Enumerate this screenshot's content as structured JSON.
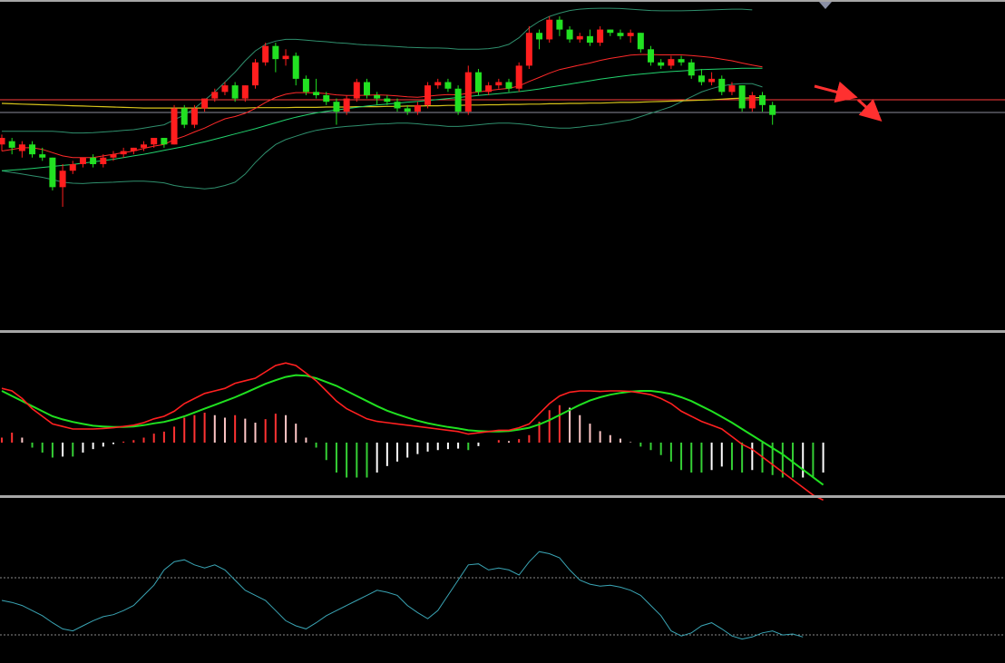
{
  "chart_data": {
    "type": "candlestick",
    "xlabel": "",
    "ylabel": "",
    "price": {
      "ylim": [
        0,
        100
      ],
      "support_level": 69.6,
      "candles": [
        {
          "o": 56,
          "c": 58,
          "h": 59,
          "l": 54
        },
        {
          "o": 57,
          "c": 55,
          "h": 58,
          "l": 53
        },
        {
          "o": 54,
          "c": 56,
          "h": 57,
          "l": 52
        },
        {
          "o": 56,
          "c": 53,
          "h": 57,
          "l": 52
        },
        {
          "o": 53,
          "c": 52,
          "h": 55,
          "l": 51
        },
        {
          "o": 52,
          "c": 43,
          "h": 52,
          "l": 42
        },
        {
          "o": 43,
          "c": 48,
          "h": 50,
          "l": 37
        },
        {
          "o": 48,
          "c": 50,
          "h": 51,
          "l": 47
        },
        {
          "o": 50,
          "c": 52,
          "h": 52,
          "l": 49
        },
        {
          "o": 52,
          "c": 50,
          "h": 53,
          "l": 49
        },
        {
          "o": 50,
          "c": 52,
          "h": 53,
          "l": 49
        },
        {
          "o": 52,
          "c": 53,
          "h": 54,
          "l": 51
        },
        {
          "o": 53,
          "c": 54,
          "h": 55,
          "l": 52
        },
        {
          "o": 54,
          "c": 55,
          "h": 55,
          "l": 53
        },
        {
          "o": 55,
          "c": 56,
          "h": 57,
          "l": 54
        },
        {
          "o": 56,
          "c": 58,
          "h": 58,
          "l": 55
        },
        {
          "o": 58,
          "c": 56,
          "h": 58,
          "l": 55
        },
        {
          "o": 56,
          "c": 67,
          "h": 68,
          "l": 56
        },
        {
          "o": 67,
          "c": 62,
          "h": 68,
          "l": 61
        },
        {
          "o": 62,
          "c": 67,
          "h": 68,
          "l": 61
        },
        {
          "o": 67,
          "c": 70,
          "h": 70,
          "l": 66
        },
        {
          "o": 70,
          "c": 72,
          "h": 73,
          "l": 69
        },
        {
          "o": 72,
          "c": 74,
          "h": 75,
          "l": 71
        },
        {
          "o": 74,
          "c": 70,
          "h": 75,
          "l": 69
        },
        {
          "o": 70,
          "c": 74,
          "h": 74,
          "l": 69
        },
        {
          "o": 74,
          "c": 81,
          "h": 82,
          "l": 73
        },
        {
          "o": 81,
          "c": 86,
          "h": 87,
          "l": 80
        },
        {
          "o": 86,
          "c": 82,
          "h": 87,
          "l": 78
        },
        {
          "o": 82,
          "c": 83,
          "h": 85,
          "l": 80
        },
        {
          "o": 83,
          "c": 76,
          "h": 84,
          "l": 74
        },
        {
          "o": 76,
          "c": 72,
          "h": 77,
          "l": 71
        },
        {
          "o": 72,
          "c": 71,
          "h": 76,
          "l": 70
        },
        {
          "o": 71,
          "c": 69,
          "h": 72,
          "l": 68
        },
        {
          "o": 69,
          "c": 66,
          "h": 70,
          "l": 62
        },
        {
          "o": 66,
          "c": 70,
          "h": 71,
          "l": 65
        },
        {
          "o": 70,
          "c": 75,
          "h": 76,
          "l": 69
        },
        {
          "o": 75,
          "c": 71,
          "h": 76,
          "l": 70
        },
        {
          "o": 71,
          "c": 70,
          "h": 72,
          "l": 68
        },
        {
          "o": 70,
          "c": 69,
          "h": 71,
          "l": 68
        },
        {
          "o": 69,
          "c": 67,
          "h": 70,
          "l": 66
        },
        {
          "o": 67,
          "c": 66,
          "h": 68,
          "l": 65
        },
        {
          "o": 66,
          "c": 68,
          "h": 69,
          "l": 65
        },
        {
          "o": 68,
          "c": 74,
          "h": 75,
          "l": 67
        },
        {
          "o": 74,
          "c": 75,
          "h": 76,
          "l": 73
        },
        {
          "o": 75,
          "c": 73,
          "h": 76,
          "l": 72
        },
        {
          "o": 73,
          "c": 66,
          "h": 74,
          "l": 65
        },
        {
          "o": 66,
          "c": 78,
          "h": 80,
          "l": 65
        },
        {
          "o": 78,
          "c": 72,
          "h": 79,
          "l": 71
        },
        {
          "o": 72,
          "c": 74,
          "h": 75,
          "l": 71
        },
        {
          "o": 74,
          "c": 75,
          "h": 76,
          "l": 73
        },
        {
          "o": 75,
          "c": 73,
          "h": 76,
          "l": 72
        },
        {
          "o": 73,
          "c": 80,
          "h": 81,
          "l": 72
        },
        {
          "o": 80,
          "c": 90,
          "h": 92,
          "l": 79
        },
        {
          "o": 90,
          "c": 88,
          "h": 91,
          "l": 85
        },
        {
          "o": 88,
          "c": 94,
          "h": 95,
          "l": 87
        },
        {
          "o": 94,
          "c": 91,
          "h": 95,
          "l": 89
        },
        {
          "o": 91,
          "c": 88,
          "h": 92,
          "l": 87
        },
        {
          "o": 88,
          "c": 89,
          "h": 90,
          "l": 87
        },
        {
          "o": 89,
          "c": 87,
          "h": 91,
          "l": 86
        },
        {
          "o": 87,
          "c": 91,
          "h": 92,
          "l": 86
        },
        {
          "o": 91,
          "c": 90,
          "h": 91,
          "l": 89
        },
        {
          "o": 90,
          "c": 89,
          "h": 91,
          "l": 88
        },
        {
          "o": 89,
          "c": 90,
          "h": 91,
          "l": 87
        },
        {
          "o": 90,
          "c": 85,
          "h": 90,
          "l": 84
        },
        {
          "o": 85,
          "c": 81,
          "h": 86,
          "l": 80
        },
        {
          "o": 81,
          "c": 80,
          "h": 82,
          "l": 79
        },
        {
          "o": 80,
          "c": 82,
          "h": 83,
          "l": 79
        },
        {
          "o": 82,
          "c": 81,
          "h": 83,
          "l": 80
        },
        {
          "o": 81,
          "c": 77,
          "h": 82,
          "l": 76
        },
        {
          "o": 77,
          "c": 75,
          "h": 79,
          "l": 74
        },
        {
          "o": 75,
          "c": 76,
          "h": 78,
          "l": 74
        },
        {
          "o": 76,
          "c": 72,
          "h": 77,
          "l": 71
        },
        {
          "o": 72,
          "c": 74,
          "h": 75,
          "l": 71
        },
        {
          "o": 74,
          "c": 67,
          "h": 74,
          "l": 66
        },
        {
          "o": 67,
          "c": 71,
          "h": 72,
          "l": 66
        },
        {
          "o": 71,
          "c": 68,
          "h": 72,
          "l": 66
        },
        {
          "o": 68,
          "c": 65,
          "h": 69,
          "l": 62
        }
      ],
      "ma_short": [
        54,
        54.5,
        55,
        55,
        54.5,
        53.5,
        52.5,
        52,
        52,
        52,
        52.5,
        53,
        53.5,
        54,
        54.8,
        55.5,
        56,
        57.5,
        58.5,
        59.8,
        61,
        62.5,
        63.8,
        64.5,
        65.5,
        67,
        68.8,
        70.3,
        71.3,
        71.8,
        71.8,
        71.7,
        71.5,
        71.1,
        70.9,
        70.9,
        71,
        71.1,
        71,
        70.8,
        70.5,
        70.4,
        70.7,
        71,
        71.2,
        71.1,
        71.6,
        72,
        72.4,
        72.8,
        73.1,
        73.8,
        75.2,
        76.4,
        77.7,
        78.8,
        79.5,
        80.2,
        80.8,
        81.6,
        82.2,
        82.7,
        83.2,
        83.4,
        83.4,
        83.3,
        83.3,
        83.3,
        83.1,
        82.8,
        82.5,
        82,
        81.5,
        80.8,
        80.2,
        79.6
      ],
      "ma_long": [
        48,
        48.2,
        48.4,
        48.7,
        49,
        49.3,
        49.6,
        49.9,
        50.3,
        50.7,
        51.1,
        51.5,
        52,
        52.5,
        53,
        53.6,
        54.2,
        54.8,
        55.4,
        56.1,
        56.8,
        57.6,
        58.4,
        59.2,
        60,
        60.8,
        61.7,
        62.6,
        63.5,
        64.3,
        65,
        65.6,
        66.1,
        66.5,
        66.9,
        67.3,
        67.7,
        68,
        68.3,
        68.6,
        68.9,
        69.1,
        69.4,
        69.7,
        70,
        70.3,
        70.6,
        70.9,
        71.2,
        71.5,
        71.8,
        72.1,
        72.5,
        72.9,
        73.4,
        73.9,
        74.4,
        74.9,
        75.4,
        75.9,
        76.3,
        76.7,
        77.1,
        77.4,
        77.7,
        78,
        78.2,
        78.4,
        78.6,
        78.8,
        78.9,
        79,
        79.1,
        79.2,
        79.2,
        79.2
      ],
      "ma_yearly": [
        68.5,
        68.4,
        68.3,
        68.2,
        68.1,
        68,
        67.9,
        67.8,
        67.7,
        67.6,
        67.5,
        67.4,
        67.3,
        67.2,
        67.1,
        67.1,
        67.1,
        67.1,
        67.1,
        67.1,
        67.1,
        67.1,
        67.1,
        67.1,
        67.1,
        67.2,
        67.2,
        67.2,
        67.2,
        67.3,
        67.3,
        67.3,
        67.4,
        67.4,
        67.4,
        67.5,
        67.5,
        67.5,
        67.6,
        67.6,
        67.7,
        67.7,
        67.8,
        67.8,
        67.9,
        67.9,
        68,
        68,
        68.1,
        68.1,
        68.2,
        68.2,
        68.3,
        68.3,
        68.4,
        68.4,
        68.5,
        68.5,
        68.6,
        68.6,
        68.7,
        68.8,
        68.8,
        68.9,
        69,
        69.1,
        69.2,
        69.3,
        69.4,
        69.5,
        69.6,
        69.8,
        70,
        70.1,
        70.2,
        70.3
      ],
      "boll_upper": [
        60,
        60,
        60,
        60,
        60,
        60,
        59.8,
        59.5,
        59.5,
        59.6,
        59.8,
        60,
        60.3,
        60.5,
        61,
        61.5,
        62,
        63.5,
        65,
        67,
        69.5,
        72,
        75,
        78,
        81.5,
        84.5,
        86.5,
        87.5,
        88,
        88,
        87.8,
        87.5,
        87.3,
        87,
        86.8,
        86.5,
        86.3,
        86.2,
        86,
        85.8,
        85.6,
        85.5,
        85.4,
        85.4,
        85.3,
        85,
        85,
        85,
        85.2,
        85.6,
        86.5,
        88.5,
        91.5,
        93.5,
        95,
        96,
        96.8,
        97.2,
        97.4,
        97.5,
        97.5,
        97.4,
        97.2,
        97,
        96.8,
        96.7,
        96.7,
        96.7,
        96.8,
        96.9,
        97,
        97.1,
        97.2,
        97.2,
        97
      ],
      "boll_lower": [
        48,
        47.5,
        47,
        46.5,
        46,
        45.3,
        44.5,
        44.2,
        44.1,
        44.3,
        44.4,
        44.5,
        44.7,
        44.8,
        44.8,
        44.6,
        44.3,
        43.5,
        43,
        42.8,
        42.5,
        42.8,
        43.5,
        44.5,
        47,
        50.5,
        53.5,
        56,
        57.5,
        58.5,
        59.5,
        60.3,
        60.8,
        61.2,
        61.5,
        61.7,
        62,
        62.2,
        62.3,
        62.5,
        62.5,
        62.3,
        62,
        61.8,
        61.5,
        61.5,
        61.7,
        62,
        62.3,
        62.5,
        62.5,
        62.3,
        62,
        61.5,
        61.2,
        61,
        61,
        61.3,
        61.7,
        62,
        62.5,
        63,
        63.5,
        64.5,
        65.5,
        66.5,
        67.5,
        69,
        70.5,
        72,
        73,
        73.8,
        74.3,
        74.5,
        74.5,
        73.5
      ],
      "projection": {
        "start": 73,
        "low": 69.6,
        "end": 75
      }
    },
    "macd": {
      "dif": [
        0.6,
        0.5,
        0.2,
        -0.2,
        -0.5,
        -0.8,
        -0.9,
        -1,
        -1,
        -1,
        -0.98,
        -0.95,
        -0.9,
        -0.85,
        -0.75,
        -0.6,
        -0.5,
        -0.3,
        0,
        0.2,
        0.4,
        0.5,
        0.6,
        0.8,
        0.9,
        1,
        1.25,
        1.5,
        1.6,
        1.5,
        1.2,
        0.9,
        0.5,
        0.1,
        -0.2,
        -0.4,
        -0.6,
        -0.7,
        -0.75,
        -0.8,
        -0.85,
        -0.9,
        -0.95,
        -1,
        -1.05,
        -1.1,
        -1.2,
        -1.15,
        -1.1,
        -1.05,
        -1.05,
        -0.95,
        -0.8,
        -0.4,
        0,
        0.3,
        0.45,
        0.5,
        0.5,
        0.48,
        0.5,
        0.5,
        0.48,
        0.42,
        0.35,
        0.2,
        0,
        -0.3,
        -0.5,
        -0.7,
        -0.85,
        -1,
        -1.3,
        -1.6,
        -1.8,
        -2.1,
        -2.4,
        -2.7,
        -3,
        -3.3,
        -3.6,
        -3.8
      ],
      "dea": [
        0.5,
        0.3,
        0.1,
        -0.1,
        -0.3,
        -0.5,
        -0.62,
        -0.72,
        -0.8,
        -0.87,
        -0.9,
        -0.92,
        -0.92,
        -0.9,
        -0.85,
        -0.78,
        -0.72,
        -0.62,
        -0.5,
        -0.35,
        -0.2,
        -0.05,
        0.1,
        0.25,
        0.42,
        0.6,
        0.78,
        0.92,
        1.05,
        1.12,
        1.1,
        1.0,
        0.85,
        0.7,
        0.5,
        0.3,
        0.1,
        -0.1,
        -0.28,
        -0.42,
        -0.55,
        -0.67,
        -0.77,
        -0.85,
        -0.92,
        -0.98,
        -1.05,
        -1.08,
        -1.1,
        -1.1,
        -1.08,
        -1.02,
        -0.95,
        -0.82,
        -0.65,
        -0.45,
        -0.25,
        -0.05,
        0.12,
        0.25,
        0.35,
        0.42,
        0.47,
        0.5,
        0.5,
        0.45,
        0.38,
        0.25,
        0.1,
        -0.1,
        -0.3,
        -0.52,
        -0.75,
        -1,
        -1.25,
        -1.5,
        -1.75,
        -2,
        -2.3,
        -2.6,
        -2.9,
        -3.2
      ],
      "ylim": [
        -4,
        4
      ]
    },
    "oscillator": {
      "values": [
        50,
        48,
        45,
        40,
        35,
        28,
        22,
        20,
        25,
        30,
        34,
        36,
        40,
        45,
        55,
        65,
        80,
        88,
        90,
        85,
        82,
        85,
        80,
        70,
        60,
        55,
        50,
        40,
        30,
        25,
        22,
        28,
        35,
        40,
        45,
        50,
        55,
        60,
        58,
        55,
        45,
        38,
        32,
        40,
        55,
        70,
        85,
        86,
        80,
        82,
        80,
        75,
        88,
        98,
        96,
        92,
        80,
        70,
        66,
        64,
        65,
        63,
        60,
        55,
        45,
        35,
        20,
        15,
        18,
        25,
        28,
        22,
        15,
        12,
        14,
        18,
        20,
        16,
        17,
        14
      ],
      "ylim": [
        0,
        100
      ],
      "upper": 80,
      "lower": 20
    },
    "colors": {
      "background": "#000000",
      "up": "#ff1e1e",
      "down": "#22e122",
      "ma_short": "#ff2a2a",
      "ma_long": "#22d26e",
      "ma_yearly": "#d6c21b",
      "boll": "#2f8f6d",
      "support": "#ff3d3d",
      "hline": "#8c8c9a",
      "divider": "#a6a6a6",
      "macd_dif": "#ff2020",
      "macd_dea": "#20e020",
      "hist_pos": "#ff3232",
      "hist_pos_weak": "#ffc7c7",
      "hist_neg": "#35cf35",
      "hist_neg_weak": "#ffffff",
      "osc": "#3aa5b5",
      "osc_guide": "#8a8a8a",
      "projection": "#ff3030"
    }
  }
}
